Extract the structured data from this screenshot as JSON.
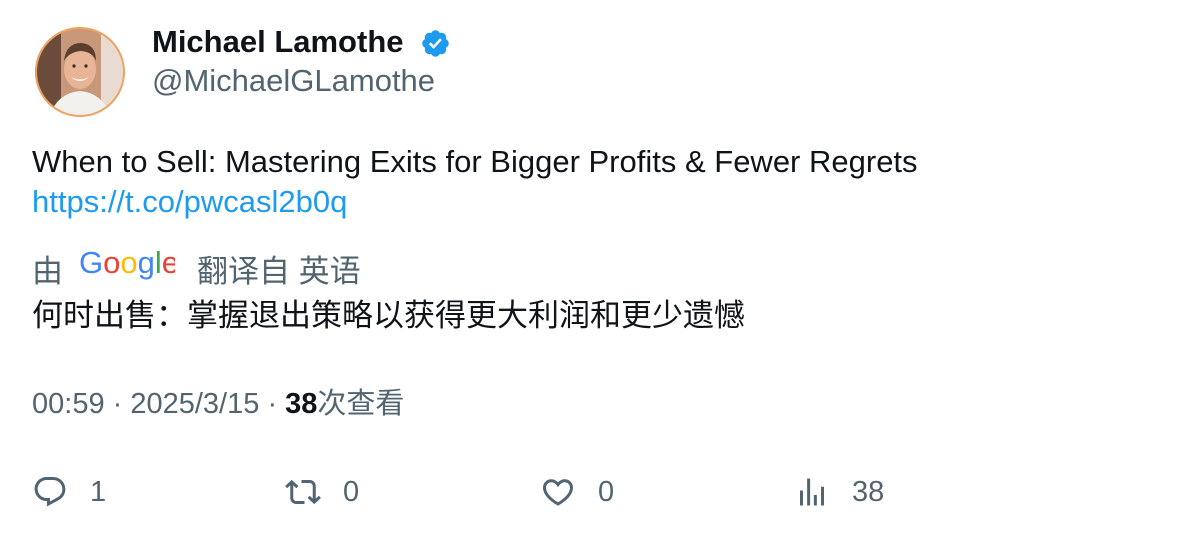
{
  "author": {
    "display_name": "Michael Lamothe",
    "handle": "@MichaelGLamothe",
    "verified": true
  },
  "tweet": {
    "text": "When to Sell: Mastering Exits for Bigger Profits & Fewer Regrets",
    "link": "https://t.co/pwcasl2b0q"
  },
  "translation": {
    "prefix": "由",
    "provider": "Google",
    "suffix": "翻译自 英语",
    "text": "何时出售：掌握退出策略以获得更大利润和更少遗憾"
  },
  "meta": {
    "time": "00:59",
    "separator": "·",
    "date": "2025/3/15",
    "views_count": "38",
    "views_label": "次查看"
  },
  "actions": {
    "reply_count": "1",
    "retweet_count": "0",
    "like_count": "0",
    "views_count": "38"
  },
  "colors": {
    "link": "#1d9bf0",
    "secondary_text": "#536471",
    "primary_text": "#0f1419",
    "verified": "#1d9bf0"
  },
  "icons": [
    "verified-badge-icon",
    "google-logo",
    "reply-icon",
    "retweet-icon",
    "like-icon",
    "views-icon"
  ]
}
